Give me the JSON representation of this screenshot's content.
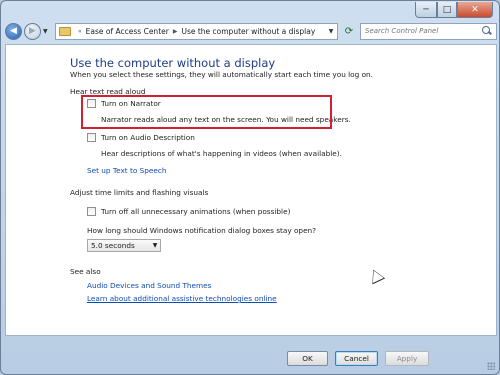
{
  "window": {
    "caption_buttons": {
      "minimize": "─",
      "maximize": "□",
      "close": "✕"
    }
  },
  "nav": {
    "back_icon": "arrow-left-icon",
    "forward_icon": "arrow-right-icon",
    "breadcrumb": [
      "Ease of Access Center",
      "Use the computer without a display"
    ],
    "search_placeholder": "Search Control Panel"
  },
  "page": {
    "title": "Use the computer without a display",
    "subtitle": "When you select these settings, they will automatically start each time you log on."
  },
  "sections": {
    "hear_text": {
      "heading": "Hear text read aloud",
      "narrator_label": "Turn on Narrator",
      "narrator_desc": "Narrator reads aloud any text on the screen. You will need speakers.",
      "audio_desc_label": "Turn on Audio Description",
      "audio_desc_desc": "Hear descriptions of what's happening in videos (when available).",
      "tts_link": "Set up Text to Speech"
    },
    "time_limits": {
      "heading": "Adjust time limits and flashing visuals",
      "animations_label": "Turn off all unnecessary animations (when possible)",
      "dialog_question": "How long should Windows notification dialog boxes stay open?",
      "dialog_value": "5.0 seconds"
    },
    "see_also": {
      "heading": "See also",
      "links": [
        "Audio Devices and Sound Themes",
        "Learn about additional assistive technologies online"
      ]
    }
  },
  "footer": {
    "ok": "OK",
    "cancel": "Cancel",
    "apply": "Apply"
  },
  "colors": {
    "title": "#1f3c8a",
    "link": "#0e4bb5",
    "highlight": "#d1202f"
  }
}
